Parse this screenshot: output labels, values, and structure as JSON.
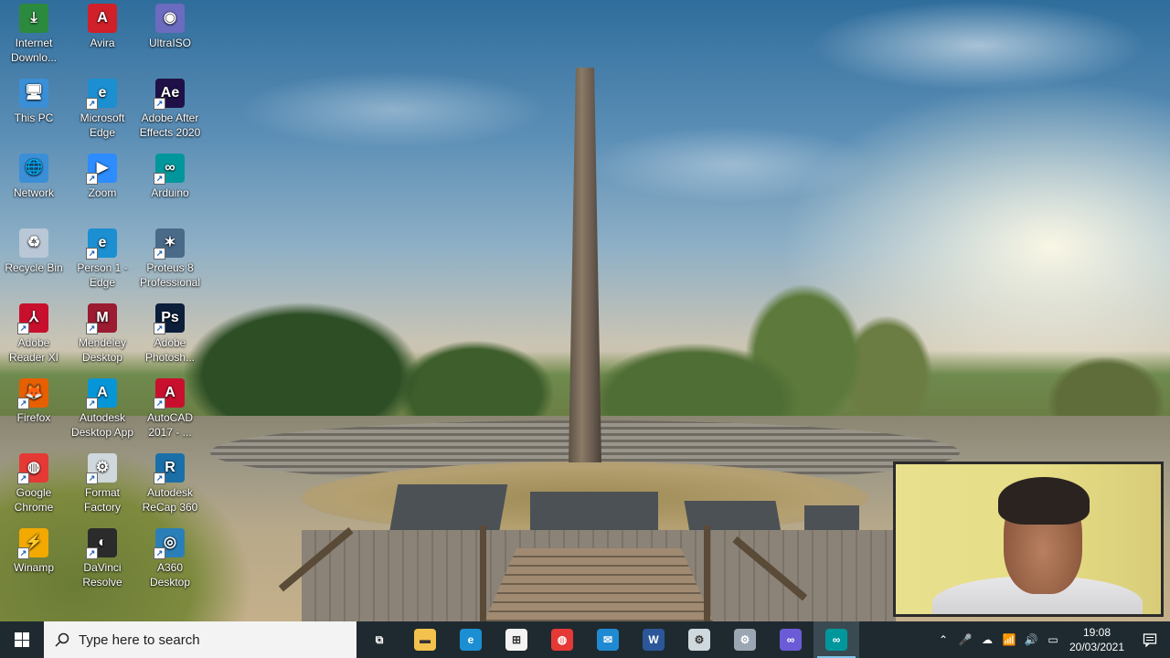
{
  "desktop_icons": [
    {
      "label": "Internet Downlo...",
      "icon": "internet-download-manager-icon",
      "color": "#2b8a3e"
    },
    {
      "label": "Avira",
      "icon": "avira-icon",
      "color": "#d0202a"
    },
    {
      "label": "UltraISO",
      "icon": "ultraiso-icon",
      "color": "#6b6bbf"
    },
    {
      "label": "This PC",
      "icon": "this-pc-icon",
      "color": "#3a8fd6"
    },
    {
      "label": "Microsoft Edge",
      "icon": "edge-icon",
      "color": "#1b8fd1"
    },
    {
      "label": "Adobe After Effects 2020",
      "icon": "after-effects-icon",
      "color": "#1f1147"
    },
    {
      "label": "Network",
      "icon": "network-icon",
      "color": "#3a8fd6"
    },
    {
      "label": "Zoom",
      "icon": "zoom-icon",
      "color": "#2d8cff"
    },
    {
      "label": "Arduino",
      "icon": "arduino-icon",
      "color": "#00979c"
    },
    {
      "label": "Recycle Bin",
      "icon": "recycle-bin-icon",
      "color": "#b9c7d6"
    },
    {
      "label": "Person 1 - Edge",
      "icon": "edge-profile-icon",
      "color": "#1b8fd1"
    },
    {
      "label": "Proteus 8 Professional",
      "icon": "proteus-icon",
      "color": "#4a6a8a"
    },
    {
      "label": "Adobe Reader XI",
      "icon": "adobe-reader-icon",
      "color": "#c8102e"
    },
    {
      "label": "Mendeley Desktop",
      "icon": "mendeley-icon",
      "color": "#9b1b30"
    },
    {
      "label": "Adobe Photosh...",
      "icon": "photoshop-icon",
      "color": "#0b1e3a"
    },
    {
      "label": "Firefox",
      "icon": "firefox-icon",
      "color": "#e66000"
    },
    {
      "label": "Autodesk Desktop App",
      "icon": "autodesk-icon",
      "color": "#0696d7"
    },
    {
      "label": "AutoCAD 2017 - ...",
      "icon": "autocad-icon",
      "color": "#c8102e"
    },
    {
      "label": "Google Chrome",
      "icon": "chrome-icon",
      "color": "#e53935"
    },
    {
      "label": "Format Factory",
      "icon": "format-factory-icon",
      "color": "#cfd8dc"
    },
    {
      "label": "Autodesk ReCap 360",
      "icon": "recap-icon",
      "color": "#1b6fa8"
    },
    {
      "label": "Winamp",
      "icon": "winamp-icon",
      "color": "#f2a900"
    },
    {
      "label": "DaVinci Resolve",
      "icon": "davinci-resolve-icon",
      "color": "#2b2b2b"
    },
    {
      "label": "A360 Desktop",
      "icon": "a360-icon",
      "color": "#2a7fb8"
    }
  ],
  "icon_glyphs": [
    "⤓",
    "A",
    "◉",
    "🖥",
    "e",
    "Ae",
    "🌐",
    "▶",
    "∞",
    "♻",
    "e",
    "✶",
    "⅄",
    "M",
    "Ps",
    "🦊",
    "A",
    "A",
    "◍",
    "⚙",
    "R",
    "⚡",
    "◐",
    "◎"
  ],
  "taskbar": {
    "search_placeholder": "Type here to search",
    "apps": [
      {
        "name": "task-view",
        "glyph": "⧉",
        "color": "transparent"
      },
      {
        "name": "file-explorer",
        "glyph": "▬",
        "color": "#f2c14e"
      },
      {
        "name": "edge",
        "glyph": "e",
        "color": "#1b8fd1"
      },
      {
        "name": "microsoft-store",
        "glyph": "⊞",
        "color": "#f3f3f3"
      },
      {
        "name": "chrome",
        "glyph": "◍",
        "color": "#e53935"
      },
      {
        "name": "mail",
        "glyph": "✉",
        "color": "#1f8ad2"
      },
      {
        "name": "word",
        "glyph": "W",
        "color": "#2b579a"
      },
      {
        "name": "format-factory",
        "glyph": "⚙",
        "color": "#cfd8dc"
      },
      {
        "name": "media-tool",
        "glyph": "⚙",
        "color": "#9aa7b2"
      },
      {
        "name": "infinity-app",
        "glyph": "∞",
        "color": "#6b5bd6"
      },
      {
        "name": "arduino",
        "glyph": "∞",
        "color": "#00979c"
      }
    ],
    "active_app": "arduino",
    "tray_glyphs": [
      "⌃",
      "🎤",
      "☁",
      "📶",
      "🔊",
      "▭"
    ],
    "time": "19:08",
    "date": "20/03/2021"
  }
}
